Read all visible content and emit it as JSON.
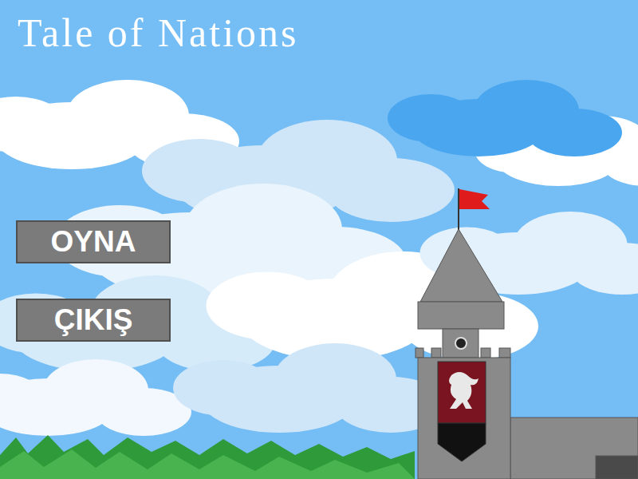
{
  "title": "Tale of Nations",
  "menu": [
    {
      "label": "OYNA"
    },
    {
      "label": "ÇIKIŞ"
    }
  ]
}
